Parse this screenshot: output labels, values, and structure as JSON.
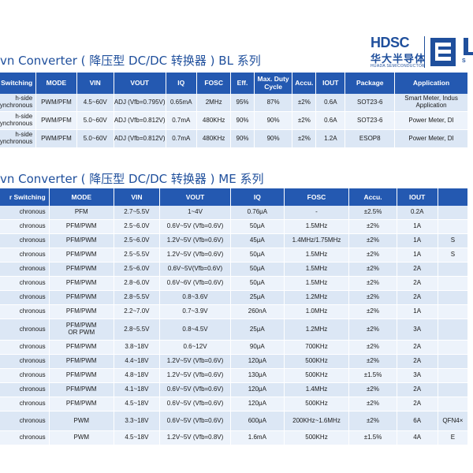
{
  "logo": {
    "brand": "HDSC",
    "cn": "华大半导体",
    "en": "HUADA SEMICONDUCTOR",
    "mark_text": "S"
  },
  "section1": {
    "title": "vn Converter ( 降压型 DC/DC 转换器 ) BL 系列",
    "headers": [
      "Switching",
      "MODE",
      "VIN",
      "VOUT",
      "IQ",
      "FOSC",
      "Eff.",
      "Max. Duty Cycle",
      "Accu.",
      "IOUT",
      "Package",
      "Application"
    ],
    "rows": [
      [
        "h-side / ynchronous",
        "PWM/PFM",
        "4.5~60V",
        "ADJ (Vfb=0.795V)",
        "0.65mA",
        "2MHz",
        "95%",
        "87%",
        "±2%",
        "0.6A",
        "SOT23-6",
        "Smart Meter, Indus / Application"
      ],
      [
        "h-side / ynchronous",
        "PWM/PFM",
        "5.0~60V",
        "ADJ (Vfb=0.812V)",
        "0.7mA",
        "480KHz",
        "90%",
        "90%",
        "±2%",
        "0.6A",
        "SOT23-6",
        "Power Meter, DI"
      ],
      [
        "h-side / ynchronous",
        "PWM/PFM",
        "5.0~60V",
        "ADJ (Vfb=0.812V)",
        "0.7mA",
        "480KHz",
        "90%",
        "90%",
        "±2%",
        "1.2A",
        "ESOP8",
        "Power Meter, DI"
      ]
    ]
  },
  "section2": {
    "title": "vn Converter ( 降压型 DC/DC 转换器 ) ME 系列",
    "headers": [
      "r Switching",
      "MODE",
      "VIN",
      "VOUT",
      "IQ",
      "FOSC",
      "Accu.",
      "IOUT",
      ""
    ],
    "rows": [
      [
        "chronous",
        "PFM",
        "2.7~5.5V",
        "1~4V",
        "0.76μA",
        "-",
        "±2.5%",
        "0.2A",
        ""
      ],
      [
        "chronous",
        "PFM/PWM",
        "2.5~6.0V",
        "0.6V~5V (Vfb=0.6V)",
        "50μA",
        "1.5MHz",
        "±2%",
        "1A",
        ""
      ],
      [
        "chronous",
        "PFM/PWM",
        "2.5~6.0V",
        "1.2V~5V (Vfb=0.6V)",
        "45μA",
        "1.4MHz/1.75MHz",
        "±2%",
        "1A",
        "S"
      ],
      [
        "chronous",
        "PFM/PWM",
        "2.5~5.5V",
        "1.2V~5V (Vfb=0.6V)",
        "50μA",
        "1.5MHz",
        "±2%",
        "1A",
        "S"
      ],
      [
        "chronous",
        "PFM/PWM",
        "2.5~6.0V",
        "0.6V~5V(Vfb=0.6V)",
        "50μA",
        "1.5MHz",
        "±2%",
        "2A",
        ""
      ],
      [
        "chronous",
        "PFM/PWM",
        "2.8~6.0V",
        "0.6V~6V (Vfb=0.6V)",
        "50μA",
        "1.5MHz",
        "±2%",
        "2A",
        ""
      ],
      [
        "chronous",
        "PFM/PWM",
        "2.8~5.5V",
        "0.8~3.6V",
        "25μA",
        "1.2MHz",
        "±2%",
        "2A",
        ""
      ],
      [
        "chronous",
        "PFM/PWM",
        "2.2~7.0V",
        "0.7~3.9V",
        "260nA",
        "1.0MHz",
        "±2%",
        "1A",
        ""
      ],
      [
        "chronous",
        "PFM/PWM / OR PWM",
        "2.8~5.5V",
        "0.8~4.5V",
        "25μA",
        "1.2MHz",
        "±2%",
        "3A",
        ""
      ],
      [
        "chronous",
        "PFM/PWM",
        "3.8~18V",
        "0.6~12V",
        "90μA",
        "700KHz",
        "±2%",
        "2A",
        ""
      ],
      [
        "chronous",
        "PFM/PWM",
        "4.4~18V",
        "1.2V~5V (Vfb=0.6V)",
        "120μA",
        "500KHz",
        "±2%",
        "2A",
        ""
      ],
      [
        "chronous",
        "PFM/PWM",
        "4.8~18V",
        "1.2V~5V (Vfb=0.6V)",
        "130μA",
        "500KHz",
        "±1.5%",
        "3A",
        ""
      ],
      [
        "chronous",
        "PFM/PWM",
        "4.1~18V",
        "0.6V~5V (Vfb=0.6V)",
        "120μA",
        "1.4MHz",
        "±2%",
        "2A",
        ""
      ],
      [
        "chronous",
        "PFM/PWM",
        "4.5~18V",
        "0.6V~5V (Vfb=0.6V)",
        "120μA",
        "500KHz",
        "±2%",
        "2A",
        ""
      ],
      [
        "chronous",
        "PWM",
        "3.3~18V",
        "0.6V~5V (Vfb=0.6V)",
        "600μA",
        "200KHz~1.6MHz",
        "±2%",
        "6A",
        "QFN4×"
      ],
      [
        "chronous",
        "PWM",
        "4.5~18V",
        "1.2V~5V (Vfb=0.8V)",
        "1.6mA",
        "500KHz",
        "±1.5%",
        "4A",
        "E"
      ]
    ]
  },
  "colors": {
    "header_bg": "#2459b1",
    "title": "#1f4f9c",
    "row_a": "#dce7f5",
    "row_b": "#edf3fb"
  }
}
